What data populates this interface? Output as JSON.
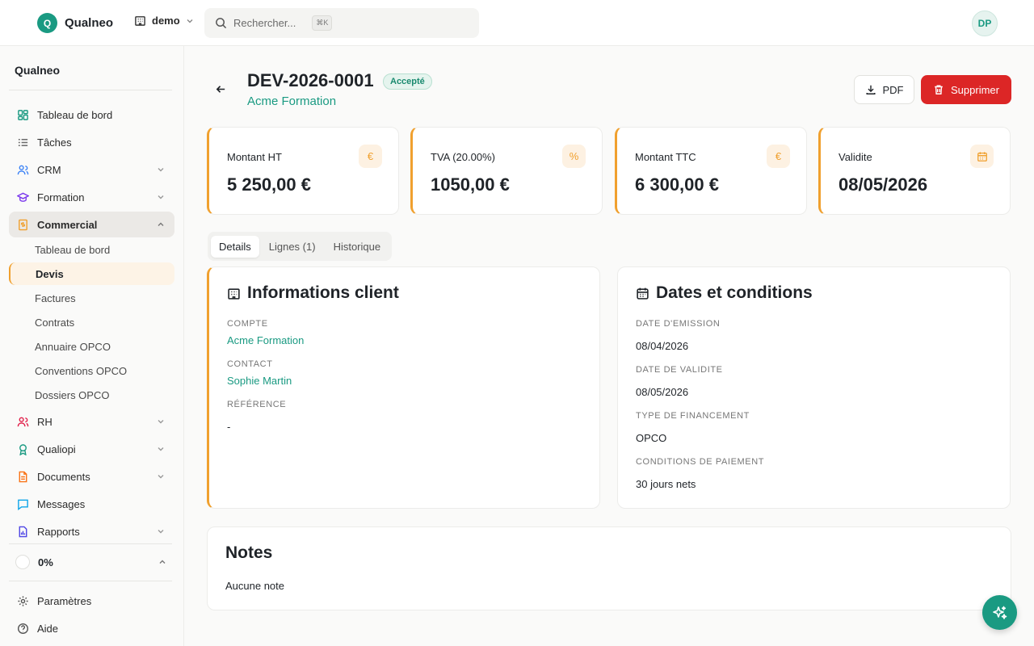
{
  "brand": {
    "logo": "Q",
    "name": "Qualneo"
  },
  "workspace": {
    "name": "demo"
  },
  "search": {
    "placeholder": "Rechercher...",
    "shortcut": "⌘K"
  },
  "user": {
    "initials": "DP"
  },
  "sidebar": {
    "title": "Qualneo",
    "items": [
      {
        "label": "Tableau de bord",
        "icon": "dashboard-icon",
        "color": "#1a9a82"
      },
      {
        "label": "Tâches",
        "icon": "list-checks-icon",
        "color": "#6b6b6b"
      },
      {
        "label": "CRM",
        "icon": "users-icon",
        "color": "#3b82f6"
      },
      {
        "label": "Formation",
        "icon": "graduation-cap-icon",
        "color": "#7c3aed"
      },
      {
        "label": "Commercial",
        "icon": "receipt-icon",
        "color": "#f0a02e"
      }
    ],
    "sub_items": [
      "Tableau de bord",
      "Devis",
      "Factures",
      "Contrats",
      "Annuaire OPCO",
      "Conventions OPCO",
      "Dossiers OPCO"
    ],
    "items_after": [
      {
        "label": "RH",
        "icon": "users-icon",
        "color": "#e11d48"
      },
      {
        "label": "Qualiopi",
        "icon": "award-icon",
        "color": "#1a9a82"
      },
      {
        "label": "Documents",
        "icon": "file-icon",
        "color": "#f97316"
      },
      {
        "label": "Messages",
        "icon": "message-icon",
        "color": "#0ea5e9"
      },
      {
        "label": "Rapports",
        "icon": "report-icon",
        "color": "#4f46e5"
      }
    ],
    "progress": "0%",
    "footer": [
      {
        "label": "Paramètres",
        "icon": "gear-icon"
      },
      {
        "label": "Aide",
        "icon": "help-icon"
      }
    ]
  },
  "quote": {
    "number": "DEV-2026-0001",
    "status": "Accepté",
    "client": "Acme Formation",
    "pdf_label": "PDF",
    "delete_label": "Supprimer"
  },
  "stats": [
    {
      "label": "Montant HT",
      "value": "5 250,00 €",
      "icon": "€"
    },
    {
      "label": "TVA (20.00%)",
      "value": "1050,00 €",
      "icon": "%"
    },
    {
      "label": "Montant TTC",
      "value": "6 300,00 €",
      "icon": "€"
    },
    {
      "label": "Validite",
      "value": "08/05/2026",
      "icon": "calendar-icon"
    }
  ],
  "tabs": [
    "Details",
    "Lignes (1)",
    "Historique"
  ],
  "client_info": {
    "title": "Informations client",
    "account_label": "Compte",
    "account": "Acme Formation",
    "contact_label": "Contact",
    "contact": "Sophie Martin",
    "reference_label": "Référence",
    "reference": "-"
  },
  "dates": {
    "title": "Dates et conditions",
    "issue_label": "Date d'emission",
    "issue": "08/04/2026",
    "validity_label": "Date de validite",
    "validity": "08/05/2026",
    "financing_label": "Type de financement",
    "financing": "OPCO",
    "payment_label": "Conditions de paiement",
    "payment": "30 jours nets"
  },
  "notes": {
    "title": "Notes",
    "body": "Aucune note"
  },
  "colors": {
    "accent": "#f0a02e",
    "brand": "#1a9a82",
    "danger": "#dc2626"
  }
}
